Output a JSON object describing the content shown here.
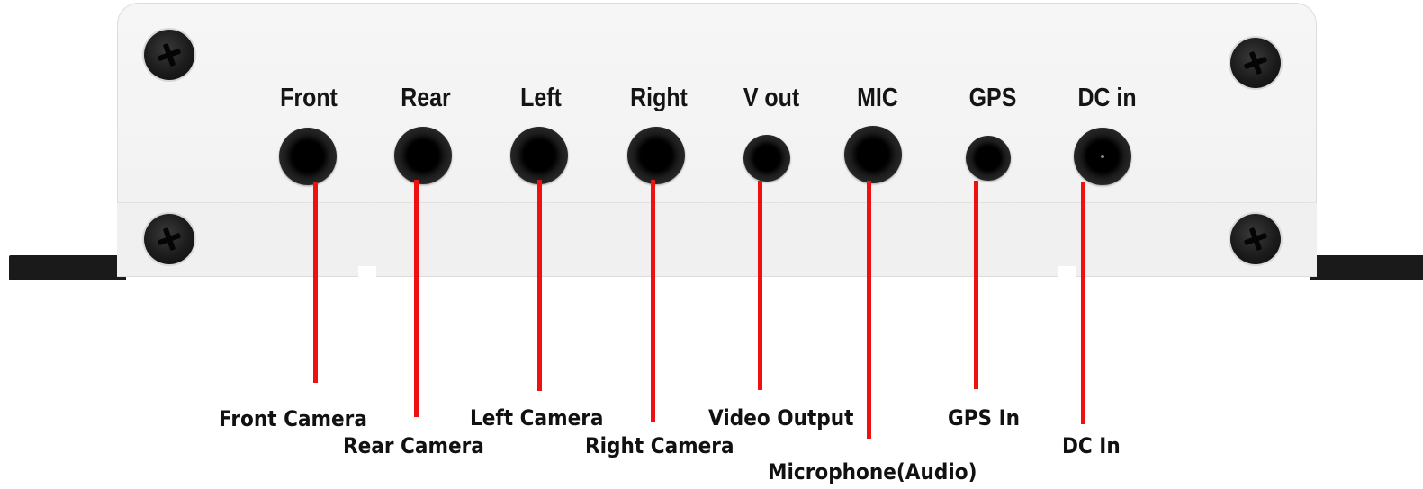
{
  "ports": [
    {
      "panel_label": "Front",
      "callout": "Front Camera"
    },
    {
      "panel_label": "Rear",
      "callout": "Rear Camera"
    },
    {
      "panel_label": "Left",
      "callout": "Left Camera"
    },
    {
      "panel_label": "Right",
      "callout": "Right Camera"
    },
    {
      "panel_label": "V out",
      "callout": "Video Output"
    },
    {
      "panel_label": "MIC",
      "callout": "Microphone(Audio)"
    },
    {
      "panel_label": "GPS",
      "callout": "GPS In"
    },
    {
      "panel_label": "DC in",
      "callout": "DC In"
    }
  ],
  "colors": {
    "leader_line": "#ee1111",
    "panel": "#f4f4f4",
    "jack": "#0d0d0d"
  }
}
